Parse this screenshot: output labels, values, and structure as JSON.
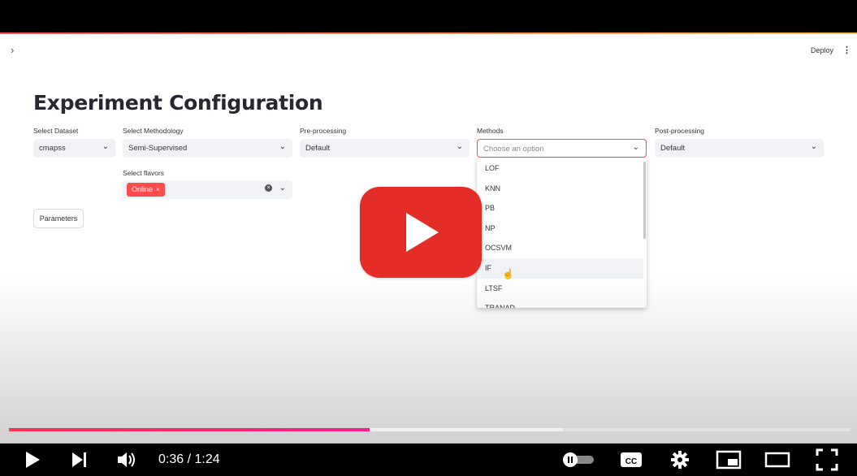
{
  "app": {
    "sidebar_toggle": "›",
    "deploy_label": "Deploy",
    "menu_label": "⋮",
    "title": "Experiment Configuration"
  },
  "form": {
    "dataset": {
      "label": "Select Dataset",
      "value": "cmapss"
    },
    "methodology": {
      "label": "Select Methodology",
      "value": "Semi-Supervised"
    },
    "preprocessing": {
      "label": "Pre-processing",
      "value": "Default"
    },
    "methods": {
      "label": "Methods",
      "placeholder": "Choose an option"
    },
    "postprocessing": {
      "label": "Post-processing",
      "value": "Default"
    },
    "flavors": {
      "label": "Select flavors",
      "tag": "Online",
      "tag_remove": "×"
    },
    "parameters_button": "Parameters"
  },
  "methods_options": [
    "LOF",
    "KNN",
    "PB",
    "NP",
    "OCSVM",
    "IF",
    "LTSF",
    "TRANAD"
  ],
  "methods_highlighted": "IF",
  "player": {
    "time": "0:36 / 1:24",
    "played_fraction": 0.429,
    "buffered_fraction": 0.658,
    "accent_color": "#ff0033"
  },
  "icons": {
    "play": "play-icon",
    "next": "next-icon",
    "volume": "volume-icon",
    "autoplay": "autoplay-toggle-icon",
    "captions": "captions-icon",
    "settings": "gear-icon",
    "miniplayer": "miniplayer-icon",
    "theater": "theater-icon",
    "fullscreen": "fullscreen-icon"
  }
}
